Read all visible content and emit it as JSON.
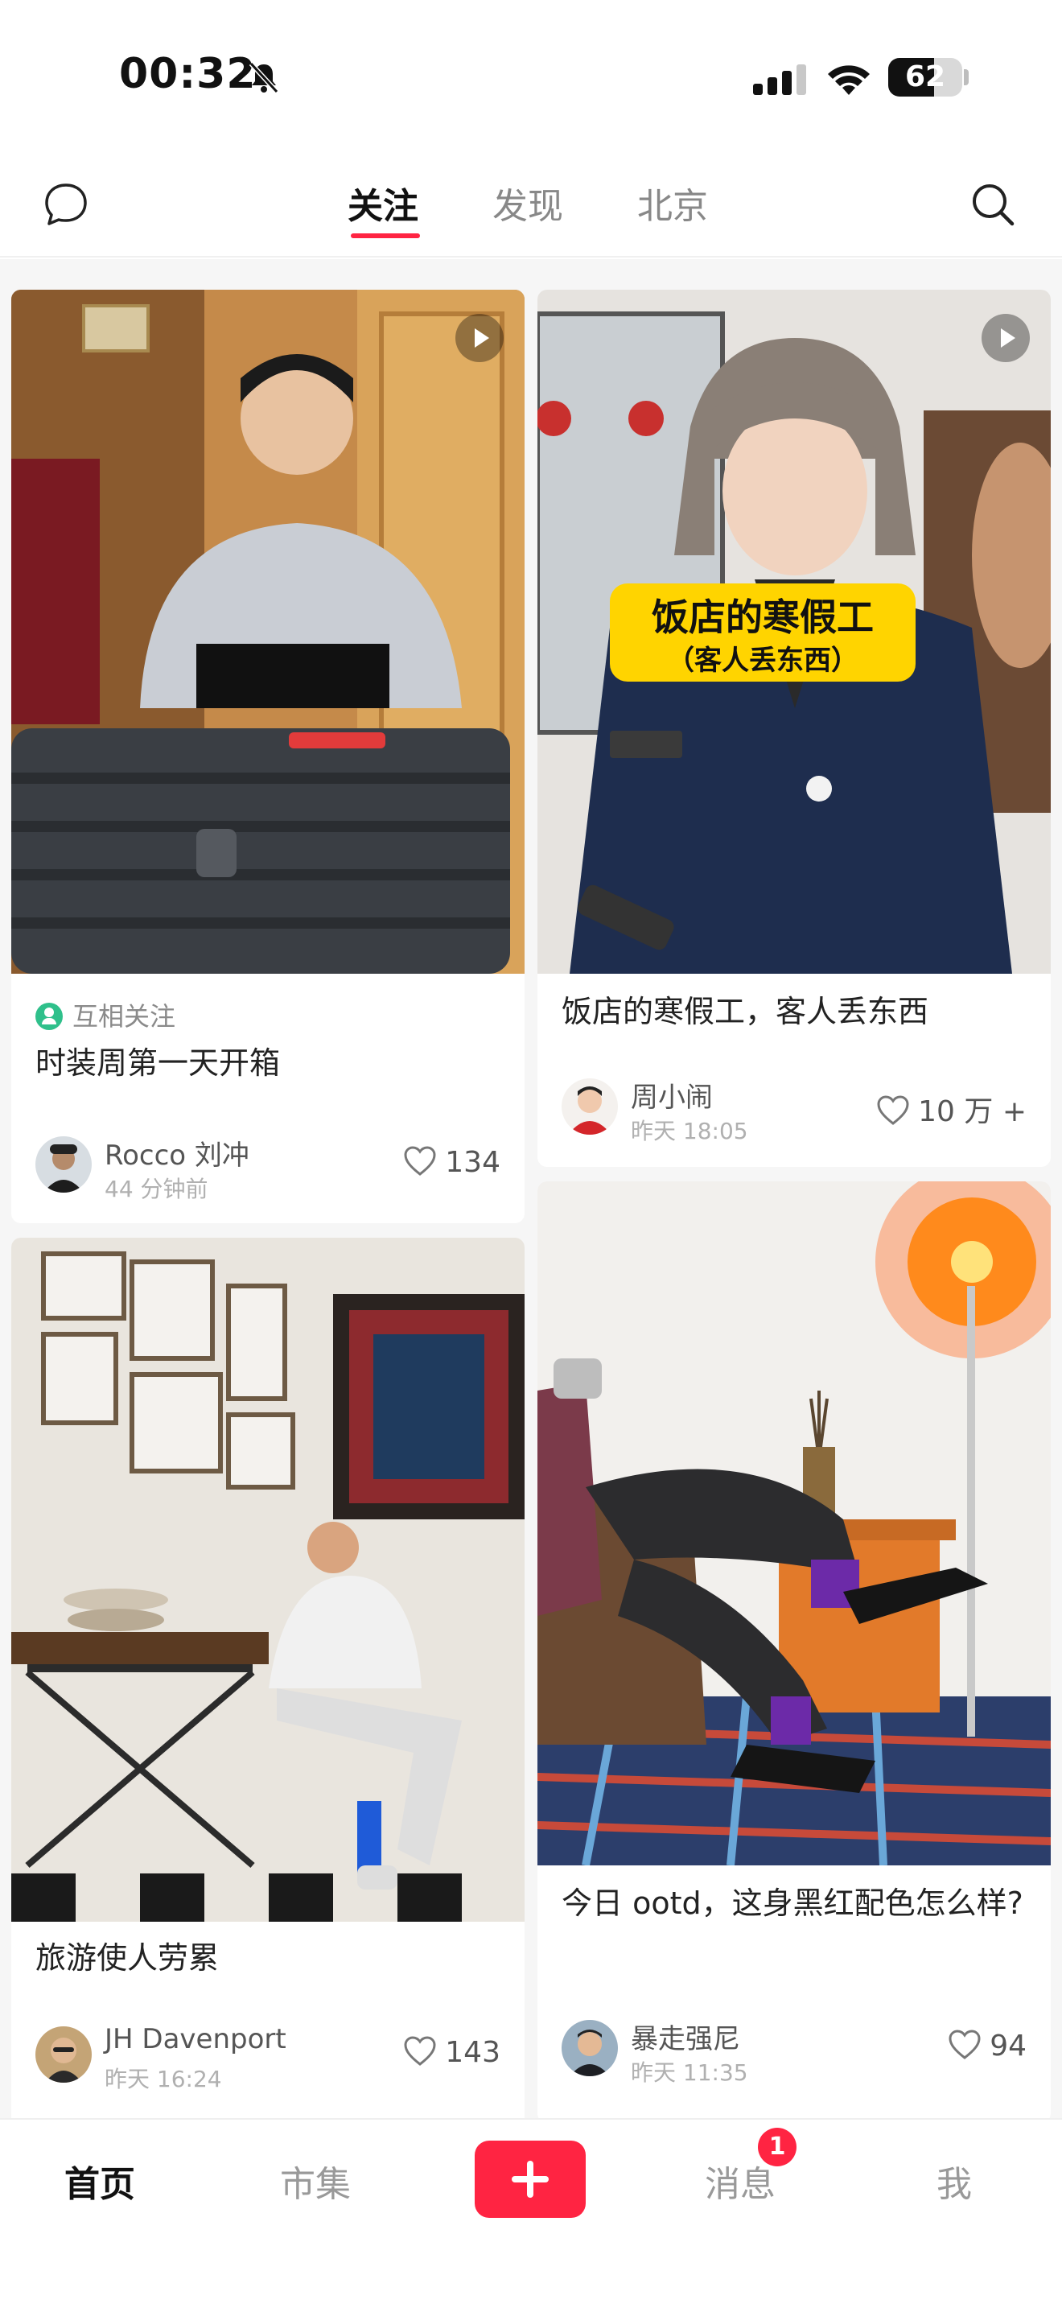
{
  "status_bar": {
    "time": "00:32",
    "battery": "62",
    "battery_level": 0.62
  },
  "top_nav": {
    "tabs": [
      {
        "label": "关注",
        "active": true
      },
      {
        "label": "发现",
        "active": false
      },
      {
        "label": "北京",
        "active": false
      }
    ],
    "left_icon": "chat-bubble-icon",
    "right_icon": "search-icon",
    "accent_color": "#ff2442"
  },
  "feed": {
    "cards": [
      {
        "mutual_label": "互相关注",
        "title": "时装周第一天开箱",
        "author": "Rocco 刘冲",
        "time": "44 分钟前",
        "likes": "134",
        "has_video": true
      },
      {
        "overlay_text_line1": "饭店的寒假工",
        "overlay_text_line2": "（客人丢东西）",
        "title": "饭店的寒假工，客人丢东西",
        "author": "周小闹",
        "time": "昨天 18:05",
        "likes": "10 万 +",
        "has_video": true
      },
      {
        "title": "旅游使人劳累",
        "author": "JH Davenport",
        "time": "昨天 16:24",
        "likes": "143",
        "has_video": false
      },
      {
        "title": "今日 ootd，这身黑红配色怎么样?",
        "author": "暴走强尼",
        "time": "昨天 11:35",
        "likes": "94",
        "has_video": false
      }
    ]
  },
  "tab_bar": {
    "items": [
      {
        "label": "首页",
        "active": true
      },
      {
        "label": "市集",
        "active": false
      },
      {
        "label": "消息",
        "active": false,
        "badge": "1"
      },
      {
        "label": "我",
        "active": false
      }
    ],
    "publish_icon": "plus-icon"
  }
}
